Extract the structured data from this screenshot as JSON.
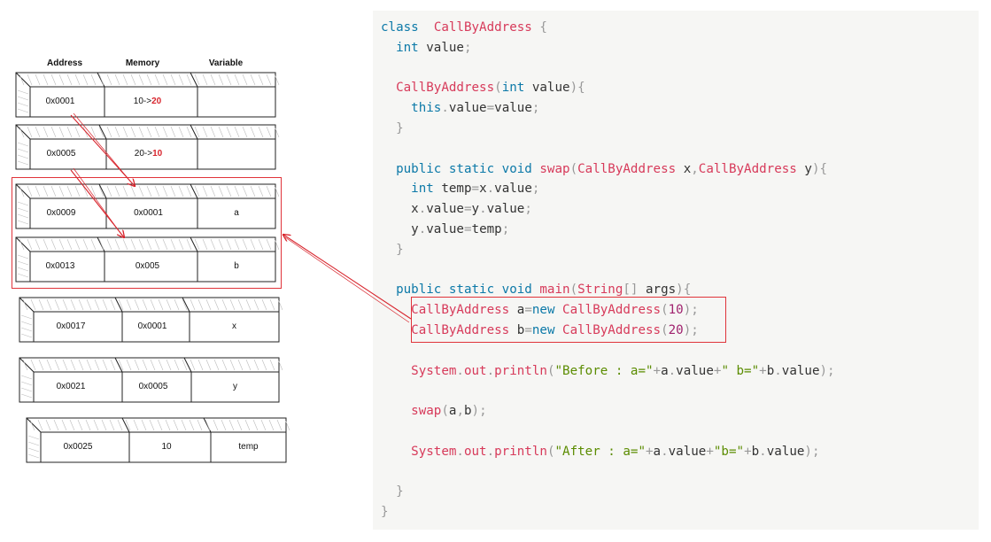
{
  "diagram": {
    "headers": {
      "address": "Address",
      "memory": "Memory",
      "variable": "Variable"
    },
    "rows": [
      {
        "address": "0x0001",
        "memory_prefix": "10->",
        "memory_highlight": "20",
        "variable": ""
      },
      {
        "address": "0x0005",
        "memory_prefix": "20->",
        "memory_highlight": "10",
        "variable": ""
      },
      {
        "address": "0x0009",
        "memory_prefix": "0x0001",
        "memory_highlight": "",
        "variable": "a"
      },
      {
        "address": "0x0013",
        "memory_prefix": "0x005",
        "memory_highlight": "",
        "variable": "b"
      },
      {
        "address": "0x0017",
        "memory_prefix": "0x0001",
        "memory_highlight": "",
        "variable": "x"
      },
      {
        "address": "0x0021",
        "memory_prefix": "0x0005",
        "memory_highlight": "",
        "variable": "y"
      },
      {
        "address": "0x0025",
        "memory_prefix": "10",
        "memory_highlight": "",
        "variable": "temp"
      }
    ],
    "accent_color": "#d8262e"
  },
  "code": {
    "lines": [
      [
        [
          "kw",
          "class"
        ],
        [
          "",
          "  "
        ],
        [
          "tp",
          "CallByAddress"
        ],
        [
          "op",
          " {"
        ]
      ],
      [
        [
          "",
          ""
        ],
        [
          "kw",
          "int"
        ],
        [
          "",
          " value"
        ],
        [
          "op",
          ";"
        ]
      ],
      [
        [
          "",
          ""
        ]
      ],
      [
        [
          "fn",
          "CallByAddress"
        ],
        [
          "op",
          "("
        ],
        [
          "kw",
          "int"
        ],
        [
          "",
          " value"
        ],
        [
          "op",
          "){"
        ]
      ],
      [
        [
          "kw",
          "this"
        ],
        [
          "op",
          "."
        ],
        [
          "",
          "value"
        ],
        [
          "op",
          "="
        ],
        [
          "",
          "value"
        ],
        [
          "op",
          ";"
        ]
      ],
      [
        [
          "op",
          "}"
        ]
      ],
      [
        [
          "",
          ""
        ]
      ],
      [
        [
          "kw",
          "public static void"
        ],
        [
          "",
          " "
        ],
        [
          "fn",
          "swap"
        ],
        [
          "op",
          "("
        ],
        [
          "tp",
          "CallByAddress"
        ],
        [
          "",
          " x"
        ],
        [
          "op",
          ","
        ],
        [
          "tp",
          "CallByAddress"
        ],
        [
          "",
          " y"
        ],
        [
          "op",
          "){"
        ]
      ],
      [
        [
          "kw",
          "int"
        ],
        [
          "",
          " temp"
        ],
        [
          "op",
          "="
        ],
        [
          "",
          "x"
        ],
        [
          "op",
          "."
        ],
        [
          "",
          "value"
        ],
        [
          "op",
          ";"
        ]
      ],
      [
        [
          "",
          "x"
        ],
        [
          "op",
          "."
        ],
        [
          "",
          "value"
        ],
        [
          "op",
          "="
        ],
        [
          "",
          "y"
        ],
        [
          "op",
          "."
        ],
        [
          "",
          "value"
        ],
        [
          "op",
          ";"
        ]
      ],
      [
        [
          "",
          "y"
        ],
        [
          "op",
          "."
        ],
        [
          "",
          "value"
        ],
        [
          "op",
          "="
        ],
        [
          "",
          "temp"
        ],
        [
          "op",
          ";"
        ]
      ],
      [
        [
          "op",
          "}"
        ]
      ],
      [
        [
          "",
          ""
        ]
      ],
      [
        [
          "kw",
          "public static void"
        ],
        [
          "",
          " "
        ],
        [
          "fn",
          "main"
        ],
        [
          "op",
          "("
        ],
        [
          "tp",
          "String"
        ],
        [
          "op",
          "[]"
        ],
        [
          "",
          " args"
        ],
        [
          "op",
          "){"
        ]
      ],
      [
        [
          "tp",
          "CallByAddress"
        ],
        [
          "",
          " a"
        ],
        [
          "op",
          "="
        ],
        [
          "kw",
          "new"
        ],
        [
          "",
          " "
        ],
        [
          "tp",
          "CallByAddress"
        ],
        [
          "op",
          "("
        ],
        [
          "nm",
          "10"
        ],
        [
          "op",
          ");"
        ]
      ],
      [
        [
          "tp",
          "CallByAddress"
        ],
        [
          "",
          " b"
        ],
        [
          "op",
          "="
        ],
        [
          "kw",
          "new"
        ],
        [
          "",
          " "
        ],
        [
          "tp",
          "CallByAddress"
        ],
        [
          "op",
          "("
        ],
        [
          "nm",
          "20"
        ],
        [
          "op",
          ");"
        ]
      ],
      [
        [
          "",
          ""
        ]
      ],
      [
        [
          "tp",
          "System"
        ],
        [
          "op",
          "."
        ],
        [
          "tp",
          "out"
        ],
        [
          "op",
          "."
        ],
        [
          "fn",
          "println"
        ],
        [
          "op",
          "("
        ],
        [
          "st",
          "\"Before : a=\""
        ],
        [
          "op",
          "+"
        ],
        [
          "",
          "a"
        ],
        [
          "op",
          "."
        ],
        [
          "",
          "value"
        ],
        [
          "op",
          "+"
        ],
        [
          "st",
          "\" b=\""
        ],
        [
          "op",
          "+"
        ],
        [
          "",
          "b"
        ],
        [
          "op",
          "."
        ],
        [
          "",
          "value"
        ],
        [
          "op",
          ");"
        ]
      ],
      [
        [
          "",
          ""
        ]
      ],
      [
        [
          "fn",
          "swap"
        ],
        [
          "op",
          "("
        ],
        [
          "",
          "a"
        ],
        [
          "op",
          ","
        ],
        [
          "",
          "b"
        ],
        [
          "op",
          ");"
        ]
      ],
      [
        [
          "",
          ""
        ]
      ],
      [
        [
          "tp",
          "System"
        ],
        [
          "op",
          "."
        ],
        [
          "tp",
          "out"
        ],
        [
          "op",
          "."
        ],
        [
          "fn",
          "println"
        ],
        [
          "op",
          "("
        ],
        [
          "st",
          "\"After : a=\""
        ],
        [
          "op",
          "+"
        ],
        [
          "",
          "a"
        ],
        [
          "op",
          "."
        ],
        [
          "",
          "value"
        ],
        [
          "op",
          "+"
        ],
        [
          "st",
          "\"b=\""
        ],
        [
          "op",
          "+"
        ],
        [
          "",
          "b"
        ],
        [
          "op",
          "."
        ],
        [
          "",
          "value"
        ],
        [
          "op",
          ");"
        ]
      ],
      [
        [
          "",
          ""
        ]
      ],
      [
        [
          "op",
          "}"
        ]
      ],
      [
        [
          "op",
          "}"
        ]
      ]
    ],
    "indents": [
      0,
      1,
      0,
      1,
      2,
      1,
      0,
      1,
      2,
      2,
      2,
      1,
      0,
      1,
      2,
      2,
      0,
      2,
      0,
      2,
      0,
      2,
      0,
      1,
      0
    ]
  }
}
